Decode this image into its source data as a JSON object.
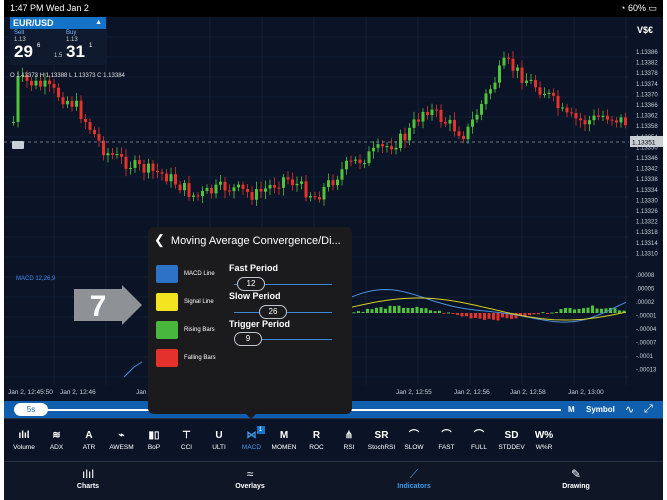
{
  "status": {
    "time_date": "1:47 PM  Wed Jan 2",
    "right": "60%"
  },
  "pair": {
    "symbol": "EUR/USD",
    "sell_label": "Sell",
    "buy_label": "Buy",
    "sell_small": "1.13",
    "buy_small": "1.13",
    "sell_big": "29",
    "sell_sup": "6",
    "buy_big": "31",
    "buy_sup": "1",
    "spread": "1.5"
  },
  "ohlc": "O 1.13373  H 1.13388  L 1.13373  C 1.13384",
  "vsc": "V$€",
  "macd_label": "MACD 12,26,9",
  "price_axis": [
    "1.13386",
    "1.13382",
    "1.13378",
    "1.13374",
    "1.13370",
    "1.13366",
    "1.13362",
    "1.13358",
    "1.13354",
    "1.13350",
    "1.13346",
    "1.13342",
    "1.13338",
    "1.13334",
    "1.13330",
    "1.13326",
    "1.13322",
    "1.13318",
    "1.13314",
    "1.13310"
  ],
  "current_price": "1.13351",
  "macd_axis": [
    ".00008",
    ".00005",
    ".00002",
    "-.00001",
    "-.00004",
    "-.00007",
    "-.0001",
    "-.00013"
  ],
  "time_axis": [
    "Jan 2, 12:45:50",
    "Jan 2, 12:46",
    "Jan 2, 12:48",
    "Jan 2, 12:56",
    "Jan 2, 12:58",
    "Jan 2, 13:00",
    "Jan 2, 12:55"
  ],
  "colors": {
    "up": "#4fc43a",
    "down": "#e5322b",
    "accent": "#1473c9",
    "macd_line": "#4a90e2",
    "signal_line": "#d9d021"
  },
  "scrubber": {
    "interval": "5s",
    "m": "M",
    "symbol": "Symbol"
  },
  "panel": {
    "title": "Moving Average Convergence/Di...",
    "lines": [
      {
        "label": "MACD Line",
        "color": "#2e72c7"
      },
      {
        "label": "Signal Line",
        "color": "#f2e51f"
      },
      {
        "label": "Rising Bars",
        "color": "#48b83d"
      },
      {
        "label": "Falling Bars",
        "color": "#e5312b"
      }
    ],
    "params": [
      {
        "label": "Fast Period",
        "value": "12"
      },
      {
        "label": "Slow Period",
        "value": "26"
      },
      {
        "label": "Trigger Period",
        "value": "9"
      }
    ]
  },
  "callout_number": "7",
  "indicators": [
    {
      "label": "Volume",
      "glyph": "ılıl"
    },
    {
      "label": "ADX",
      "glyph": "≋"
    },
    {
      "label": "ATR",
      "glyph": "A"
    },
    {
      "label": "AWESM",
      "glyph": "⌁"
    },
    {
      "label": "BoP",
      "glyph": "▮▯"
    },
    {
      "label": "CCI",
      "glyph": "⊤"
    },
    {
      "label": "ULTI",
      "glyph": "U"
    },
    {
      "label": "MACD",
      "glyph": "⋈",
      "badge": "1"
    },
    {
      "label": "MOMEN",
      "glyph": "M"
    },
    {
      "label": "ROC",
      "glyph": "R"
    },
    {
      "label": "RSI",
      "glyph": "⋔"
    },
    {
      "label": "StochRSI",
      "glyph": "SR"
    },
    {
      "label": "SLOW",
      "glyph": "⌒"
    },
    {
      "label": "FAST",
      "glyph": "⌒"
    },
    {
      "label": "FULL",
      "glyph": "⌒"
    },
    {
      "label": "STDDEV",
      "glyph": "SD"
    },
    {
      "label": "W%R",
      "glyph": "W%"
    }
  ],
  "nav": [
    {
      "label": "Charts",
      "glyph": "ılıl"
    },
    {
      "label": "Overlays",
      "glyph": "≈"
    },
    {
      "label": "Indicators",
      "glyph": "⟋"
    },
    {
      "label": "Drawing",
      "glyph": "✎"
    }
  ]
}
